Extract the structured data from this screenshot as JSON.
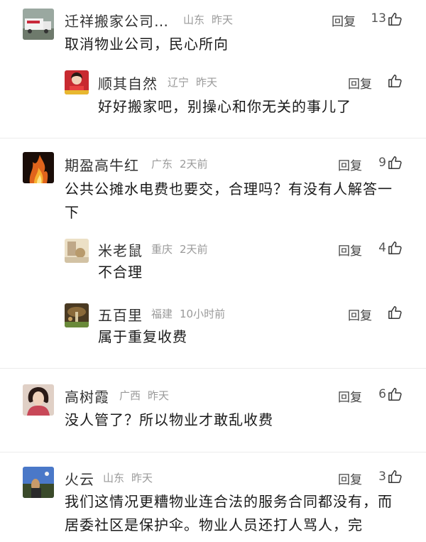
{
  "comments": [
    {
      "name": "迁祥搬家公司…",
      "location": "山东",
      "time": "昨天",
      "reply": "回复",
      "likes": "13",
      "text": "取消物业公司，民心所向",
      "replies": [
        {
          "name": "顺其自然",
          "location": "辽宁",
          "time": "昨天",
          "reply": "回复",
          "likes": "",
          "text": "好好搬家吧，别操心和你无关的事儿了"
        }
      ]
    },
    {
      "name": "期盈高牛红",
      "location": "广东",
      "time": "2天前",
      "reply": "回复",
      "likes": "9",
      "text": "公共公摊水电费也要交，合理吗？有没有人解答一下",
      "replies": [
        {
          "name": "米老鼠",
          "location": "重庆",
          "time": "2天前",
          "reply": "回复",
          "likes": "4",
          "text": "不合理"
        },
        {
          "name": "五百里",
          "location": "福建",
          "time": "10小时前",
          "reply": "回复",
          "likes": "",
          "text": "属于重复收费"
        }
      ]
    },
    {
      "name": "高树霞",
      "location": "广西",
      "time": "昨天",
      "reply": "回复",
      "likes": "6",
      "text": "没人管了？所以物业才敢乱收费",
      "replies": []
    },
    {
      "name": "火云",
      "location": "山东",
      "time": "昨天",
      "reply": "回复",
      "likes": "3",
      "text": "我们这情况更糟物业连合法的服务合同都没有，而居委社区是保护伞。物业人员还打人骂人，完",
      "replies": []
    }
  ],
  "icons": {
    "like": "thumbs-up-outline",
    "avatar_colors": [
      "#8a9a8c",
      "#c8283a",
      "#d9641e",
      "#d9c8a8",
      "#6b5a3a",
      "#d8b8a8",
      "#3a5a9a"
    ]
  }
}
